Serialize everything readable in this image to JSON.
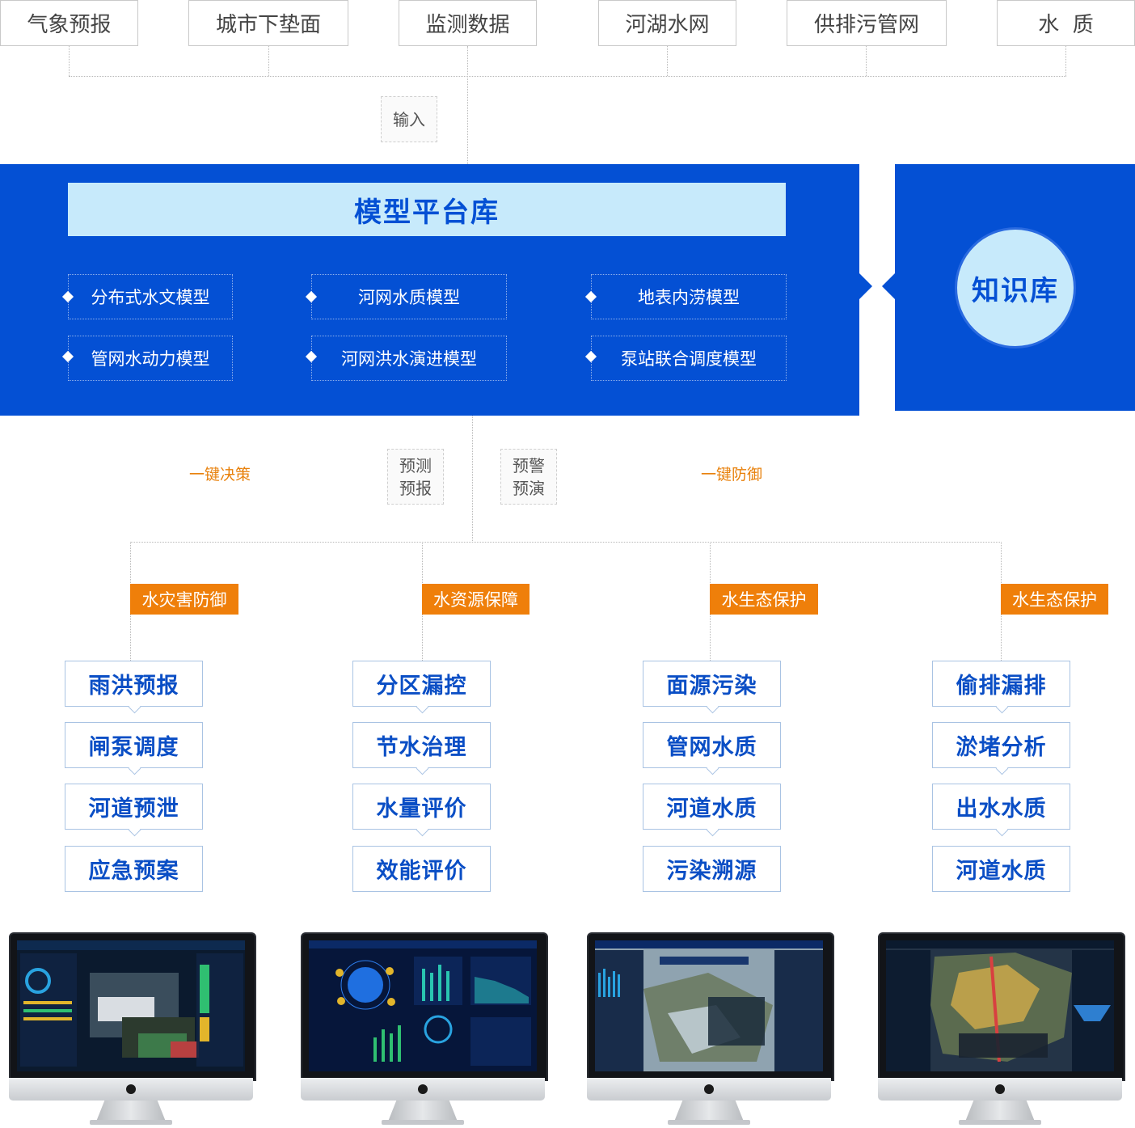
{
  "inputs": [
    "气象预报",
    "城市下垫面",
    "监测数据",
    "河湖水网",
    "供排污管网",
    "水  质"
  ],
  "input_label": "输入",
  "platform": {
    "title": "模型平台库",
    "models": [
      "分布式水文模型",
      "河网水质模型",
      "地表内涝模型",
      "管网水动力模型",
      "河网洪水演进模型",
      "泵站联合调度模型"
    ]
  },
  "knowledge_base": "知识库",
  "middle": {
    "left_orange": "一键决策",
    "right_orange": "一键防御",
    "box1": [
      "预测",
      "预报"
    ],
    "box2": [
      "预警",
      "预演"
    ]
  },
  "categories": [
    {
      "tag": "水灾害防御",
      "items": [
        "雨洪预报",
        "闸泵调度",
        "河道预泄",
        "应急预案"
      ]
    },
    {
      "tag": "水资源保障",
      "items": [
        "分区漏控",
        "节水治理",
        "水量评价",
        "效能评价"
      ]
    },
    {
      "tag": "水生态保护",
      "items": [
        "面源污染",
        "管网水质",
        "河道水质",
        "污染溯源"
      ]
    },
    {
      "tag": "水生态保护",
      "items": [
        "偷排漏排",
        "淤堵分析",
        "出水水质",
        "河道水质"
      ]
    }
  ],
  "colors": {
    "primary": "#0450d4",
    "light": "#c7eafb",
    "orange": "#ef7f0a",
    "item_text": "#0a4ec5"
  }
}
